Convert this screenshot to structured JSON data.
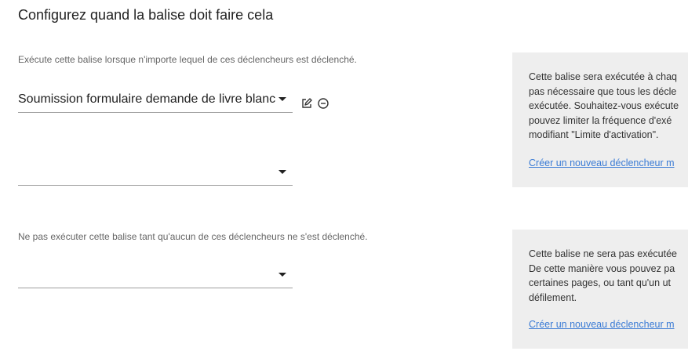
{
  "title": "Configurez quand la balise doit faire cela",
  "firing": {
    "description": "Exécute cette balise lorsque n'importe lequel de ces déclencheurs est déclenché.",
    "triggers": [
      {
        "value": "Soumission formulaire demande de livre blanc"
      },
      {
        "value": ""
      }
    ],
    "icons": [
      "edit-icon",
      "remove-circle-icon"
    ]
  },
  "blocking": {
    "description": "Ne pas exécuter cette balise tant qu'aucun de ces déclencheurs ne s'est déclenché.",
    "triggers": [
      {
        "value": ""
      }
    ]
  },
  "info_firing": {
    "lines": [
      "Cette balise sera exécutée à chaq",
      "pas nécessaire que tous les décle",
      "exécutée. Souhaitez-vous exécute",
      "pouvez limiter la fréquence d'exé",
      "modifiant \"Limite d'activation\"."
    ],
    "link": "Créer un nouveau déclencheur m"
  },
  "info_blocking": {
    "lines": [
      "Cette balise ne sera pas exécutée",
      "De cette manière vous pouvez pa",
      "certaines pages, ou tant qu'un ut",
      "défilement."
    ],
    "link": "Créer un nouveau déclencheur m"
  }
}
